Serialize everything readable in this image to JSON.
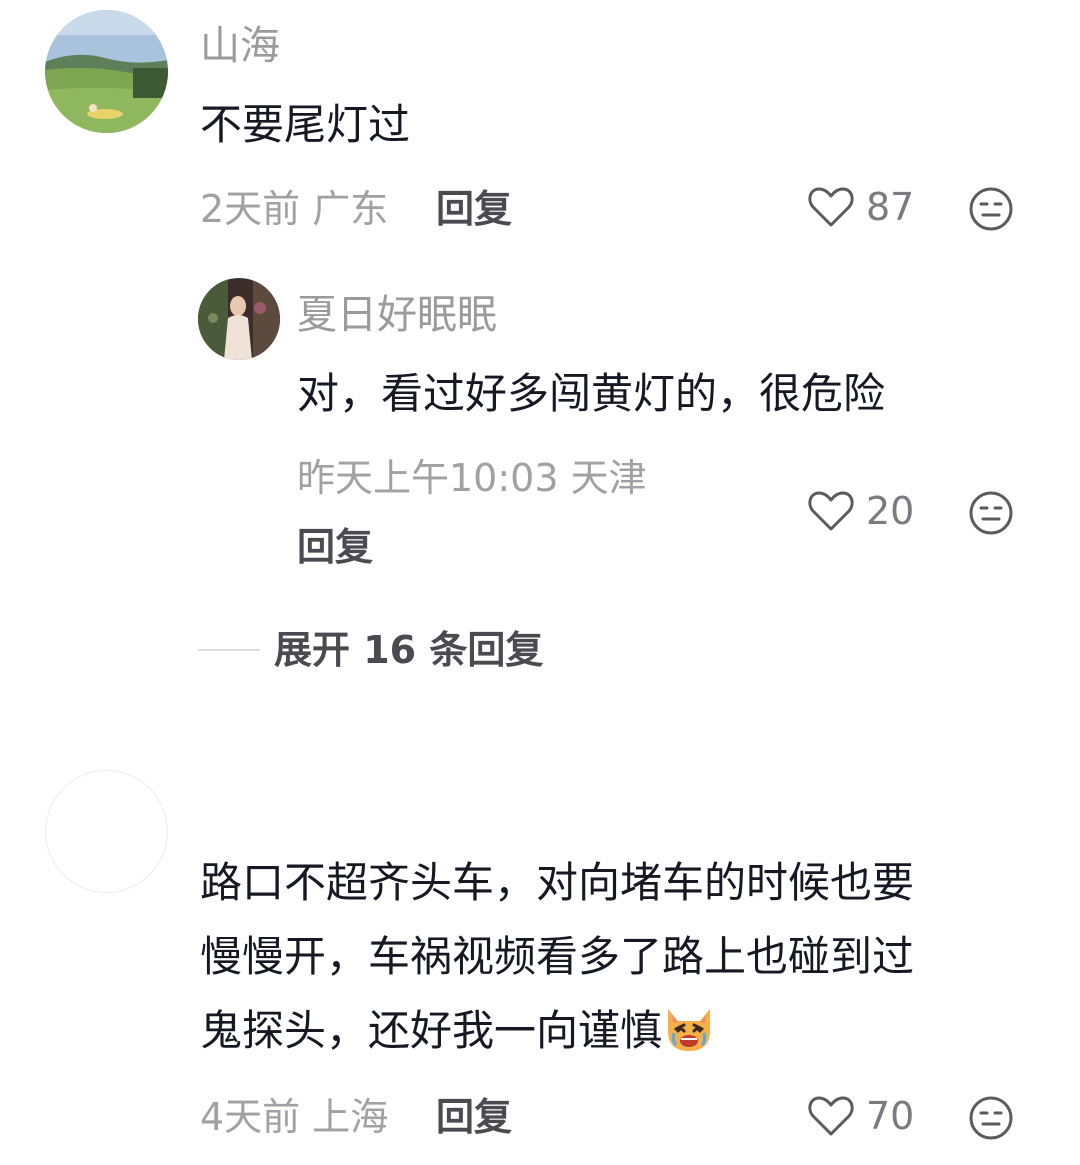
{
  "comments": [
    {
      "username": "山海",
      "text": "不要尾灯过",
      "time_location": "2天前 广东",
      "reply_label": "回复",
      "likes": "87",
      "avatar": "landscape-avatar"
    },
    {
      "username": "",
      "text_lines": [
        "路口不超齐头车，对向堵车的时候也要",
        "慢慢开，车祸视频看多了路上也碰到过",
        "鬼探头，还好我一向谨慎"
      ],
      "emoji": "crying-cat-emoji",
      "time_location": "4天前 上海",
      "reply_label": "回复",
      "likes": "70",
      "avatar": "blank-avatar"
    }
  ],
  "reply": {
    "username": "夏日好眠眠",
    "text": "对，看过好多闯黄灯的，很危险",
    "time_location": "昨天上午10:03 天津",
    "reply_label": "回复",
    "likes": "20",
    "avatar": "portrait-avatar"
  },
  "expand_replies_label": "展开 16 条回复",
  "icons": {
    "like": "heart-outline-icon",
    "dislike": "neutral-face-icon"
  },
  "colors": {
    "text": "#161823",
    "meta": "#a0a0a5",
    "username": "#9b9b9f",
    "icon": "#5a5a60"
  }
}
